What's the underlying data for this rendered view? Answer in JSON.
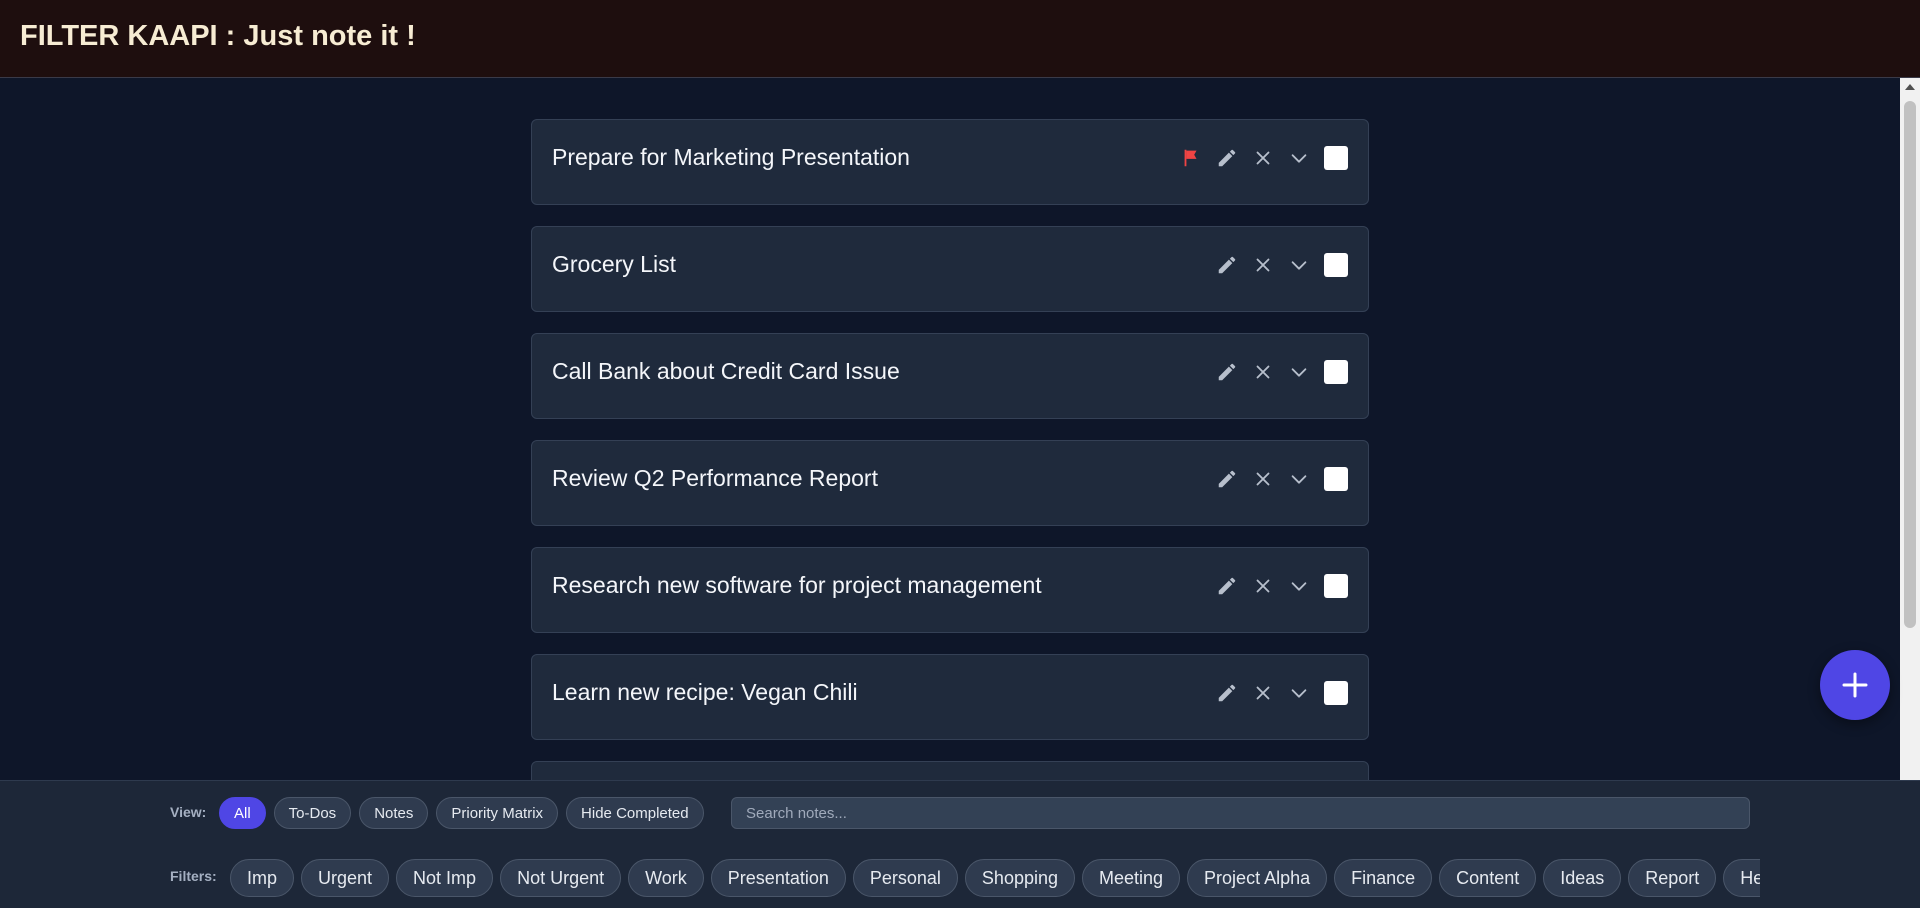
{
  "app": {
    "title": "FILTER KAAPI : Just note it !"
  },
  "notes": [
    {
      "title": "Prepare for Marketing Presentation",
      "flagged": true
    },
    {
      "title": "Grocery List",
      "flagged": false
    },
    {
      "title": "Call Bank about Credit Card Issue",
      "flagged": false
    },
    {
      "title": "Review Q2 Performance Report",
      "flagged": false
    },
    {
      "title": "Research new software for project management",
      "flagged": false
    },
    {
      "title": "Learn new recipe: Vegan Chili",
      "flagged": false
    },
    {
      "title": "",
      "flagged": false
    }
  ],
  "icons": {
    "flag": "flag-icon",
    "edit": "pencil-icon",
    "delete": "close-icon",
    "expand": "chevron-down-icon",
    "add": "plus-icon"
  },
  "colors": {
    "header_bg": "#1e0e0e",
    "page_bg": "#0e1629",
    "card_bg": "#1f2a3c",
    "accent": "#4f46e5",
    "flag": "#ef4444",
    "title_text": "#f7ecd3"
  },
  "view_bar": {
    "label": "View:",
    "options": [
      {
        "label": "All",
        "active": true
      },
      {
        "label": "To-Dos",
        "active": false
      },
      {
        "label": "Notes",
        "active": false
      },
      {
        "label": "Priority Matrix",
        "active": false
      },
      {
        "label": "Hide Completed",
        "active": false
      }
    ],
    "search_placeholder": "Search notes...",
    "search_value": ""
  },
  "filters": {
    "label": "Filters:",
    "tags": [
      "Imp",
      "Urgent",
      "Not Imp",
      "Not Urgent",
      "Work",
      "Presentation",
      "Personal",
      "Shopping",
      "Meeting",
      "Project Alpha",
      "Finance",
      "Content",
      "Ideas",
      "Report",
      "Health"
    ]
  }
}
